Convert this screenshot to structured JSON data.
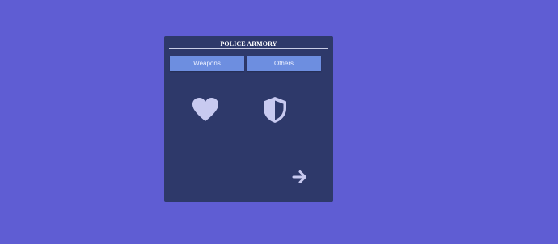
{
  "panel": {
    "title": "POLICE ARMORY"
  },
  "tabs": [
    {
      "label": "Weapons"
    },
    {
      "label": "Others"
    }
  ],
  "items": [
    {
      "icon": "heart-icon"
    },
    {
      "icon": "shield-icon"
    }
  ],
  "navigation": {
    "next_icon": "arrow-right-icon"
  },
  "colors": {
    "background": "#5f5dd3",
    "panel": "#2e396a",
    "tab": "#6d8ee0",
    "icon": "#c8caf0"
  }
}
